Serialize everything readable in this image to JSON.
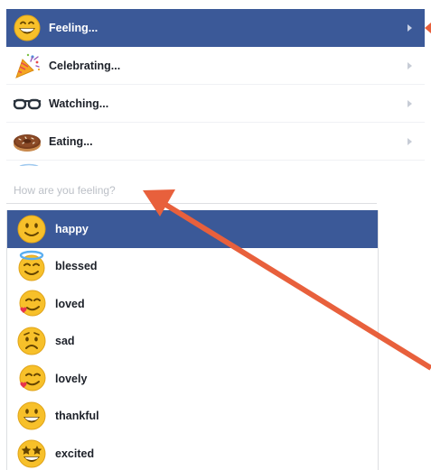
{
  "activity_menu": {
    "items": [
      {
        "label": "Feeling...",
        "icon": "grinning-face-icon",
        "selected": true
      },
      {
        "label": "Celebrating...",
        "icon": "party-popper-icon",
        "selected": false
      },
      {
        "label": "Watching...",
        "icon": "glasses-icon",
        "selected": false
      },
      {
        "label": "Eating...",
        "icon": "donut-icon",
        "selected": false
      }
    ]
  },
  "feeling_search": {
    "placeholder": "How are you feeling?"
  },
  "feelings": [
    {
      "label": "happy",
      "icon": "slightly-smiling-face-icon",
      "selected": true
    },
    {
      "label": "blessed",
      "icon": "smiling-face-with-halo-icon",
      "selected": false
    },
    {
      "label": "loved",
      "icon": "smiling-face-with-hearts-icon",
      "selected": false
    },
    {
      "label": "sad",
      "icon": "worried-face-icon",
      "selected": false
    },
    {
      "label": "lovely",
      "icon": "smiling-face-with-hearts-icon",
      "selected": false
    },
    {
      "label": "thankful",
      "icon": "grinning-face-icon",
      "selected": false
    },
    {
      "label": "excited",
      "icon": "star-struck-face-icon",
      "selected": false
    }
  ],
  "colors": {
    "selection_blue": "#3b5998",
    "annotation_arrow": "#e8603c",
    "emoji_yellow": "#f7c02a"
  }
}
